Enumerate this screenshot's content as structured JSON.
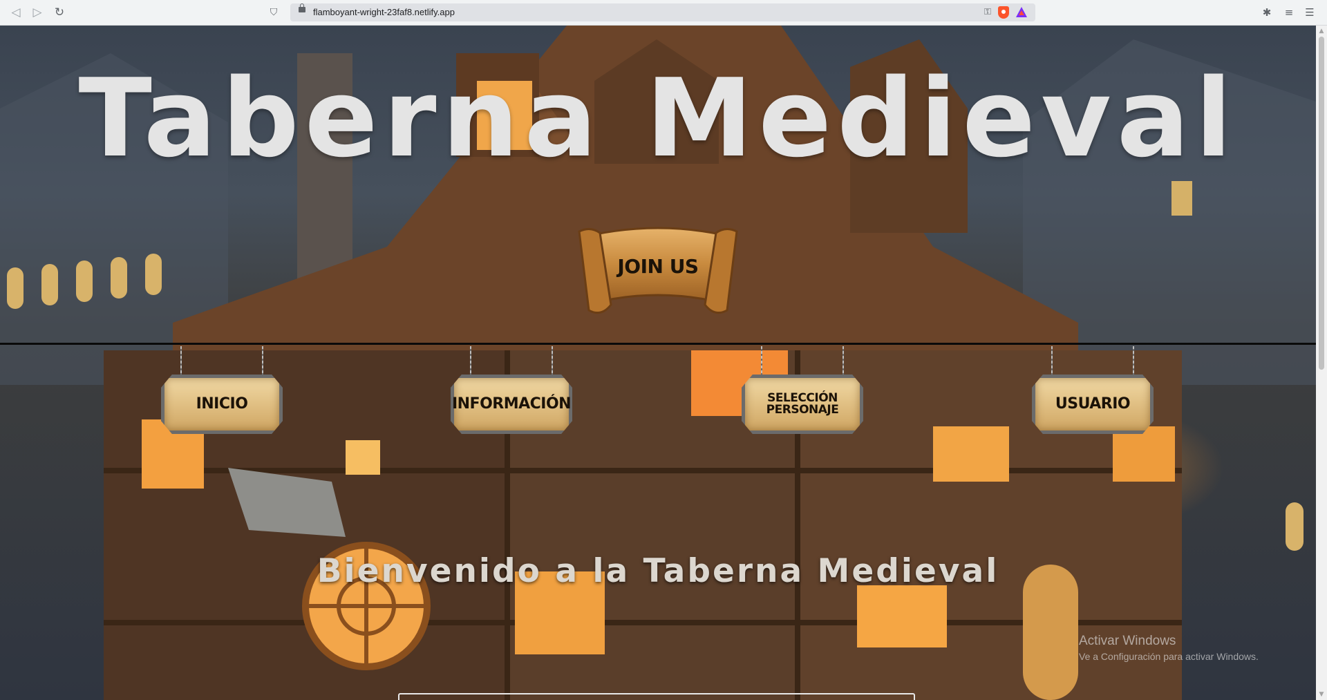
{
  "browser": {
    "url": "flamboyant-wright-23faf8.netlify.app",
    "back_icon": "back-arrow-icon",
    "forward_icon": "forward-arrow-icon",
    "reload_icon": "reload-icon",
    "bookmark_icon": "bookmark-icon",
    "key_icon": "key-icon",
    "brave_icon": "brave-shield-icon",
    "rewards_icon": "brave-rewards-icon",
    "extensions_icon": "puzzle-icon",
    "playlist_icon": "playlist-icon",
    "menu_icon": "hamburger-menu-icon"
  },
  "hero": {
    "title": "Taberna Medieval",
    "join_button": "JOIN US"
  },
  "nav": {
    "items": [
      {
        "label": "INICIO"
      },
      {
        "label": "INFORMACIÓN"
      },
      {
        "label": "SELECCIÓN PERSONAJE"
      },
      {
        "label": "USUARIO"
      }
    ]
  },
  "welcome": {
    "text": "Bienvenido a la Taberna Medieval"
  },
  "windows_watermark": {
    "line1": "Activar Windows",
    "line2": "Ve a Configuración para activar Windows."
  }
}
